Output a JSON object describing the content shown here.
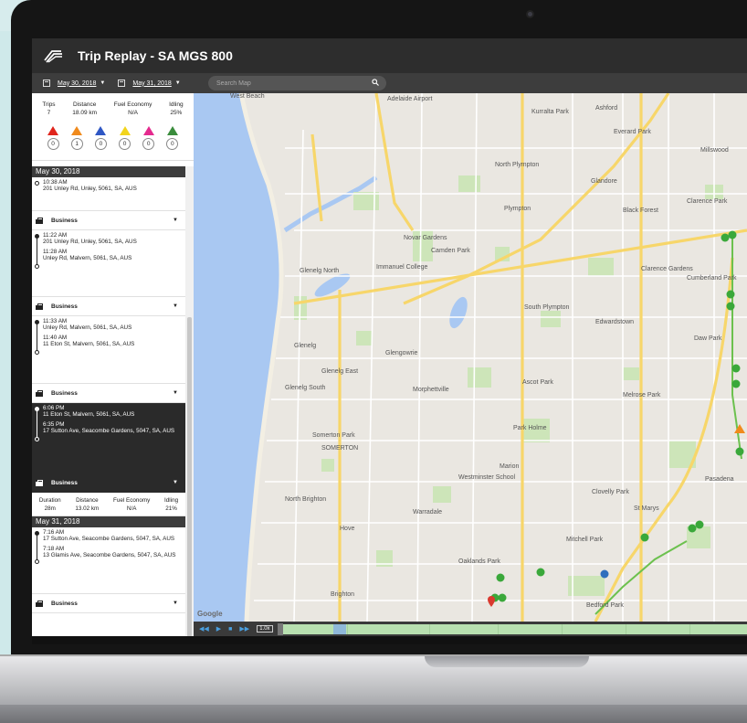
{
  "app": {
    "title": "Trip Replay - SA MGS 800"
  },
  "toolbar": {
    "start_date": "May 30, 2018",
    "end_date": "May 31, 2018",
    "search_placeholder": "Search Map"
  },
  "stats": [
    {
      "label": "Trips",
      "value": "7"
    },
    {
      "label": "Distance",
      "value": "18.09 km"
    },
    {
      "label": "Fuel Economy",
      "value": "N/A"
    },
    {
      "label": "Idling",
      "value": "25%"
    }
  ],
  "alerts": [
    {
      "color": "#e0251d",
      "count": "0"
    },
    {
      "color": "#f08a1c",
      "count": "1"
    },
    {
      "color": "#2f57c4",
      "count": "0"
    },
    {
      "color": "#f2d41c",
      "count": "0"
    },
    {
      "color": "#e42a8e",
      "count": "0"
    },
    {
      "color": "#3a8c3c",
      "count": "0"
    }
  ],
  "timeline": {
    "day1": "May 30, 2018",
    "trip0": {
      "time": "10:38 AM",
      "addr": "201 Unley Rd, Unley, 5061, SA, AUS"
    },
    "trip1": {
      "start_time": "11:22 AM",
      "start_addr": "201 Unley Rd, Unley, 5061, SA, AUS",
      "end_time": "11:28 AM",
      "end_addr": "Unley Rd, Malvern, 5061, SA, AUS"
    },
    "trip2": {
      "start_time": "11:33 AM",
      "start_addr": "Unley Rd, Malvern, 5061, SA, AUS",
      "end_time": "11:40 AM",
      "end_addr": "11 Eton St, Malvern, 5061, SA, AUS"
    },
    "trip3": {
      "start_time": "6:06 PM",
      "start_addr": "11 Eton St, Malvern, 5061, SA, AUS",
      "end_time": "6:35 PM",
      "end_addr": "17 Sutton Ave, Seacombe Gardens, 5047, SA, AUS"
    },
    "category": "Business",
    "summary": [
      {
        "label": "Duration",
        "value": "28m"
      },
      {
        "label": "Distance",
        "value": "13.02 km"
      },
      {
        "label": "Fuel Economy",
        "value": "N/A"
      },
      {
        "label": "Idling",
        "value": "21%"
      }
    ],
    "day2": "May 31, 2018",
    "trip4": {
      "start_time": "7:16 AM",
      "start_addr": "17 Sutton Ave, Seacombe Gardens, 5047, SA, AUS",
      "end_time": "7:18 AM",
      "end_addr": "13 Glamis Ave, Seacombe Gardens, 5047, SA, AUS"
    }
  },
  "map": {
    "labels": [
      "West Beach",
      "Adelaide Airport",
      "Kurralta Park",
      "Ashford",
      "Everard Park",
      "Millswood",
      "North Plympton",
      "Glandore",
      "Plympton",
      "Black Forest",
      "Clarence Park",
      "Novar Gardens",
      "Camden Park",
      "Immanuel College",
      "Glenelg North",
      "Clarence Gardens",
      "Cumberland Park",
      "South Plympton",
      "Edwardstown",
      "Daw Park",
      "Glenelg",
      "Glengowrie",
      "Glenelg East",
      "Ascot Park",
      "Melrose Park",
      "Glenelg South",
      "Morphettville",
      "Park Holme",
      "Somerton Park",
      "SOMERTON",
      "Marion",
      "Westminster School",
      "Pasadena",
      "North Brighton",
      "Warradale",
      "Clovelly Park",
      "St Marys",
      "Hove",
      "Mitchell Park",
      "Oaklands Park",
      "Brighton",
      "Bedford Park"
    ],
    "attribution": "Google"
  },
  "playback": {
    "speed": "1.0x"
  }
}
